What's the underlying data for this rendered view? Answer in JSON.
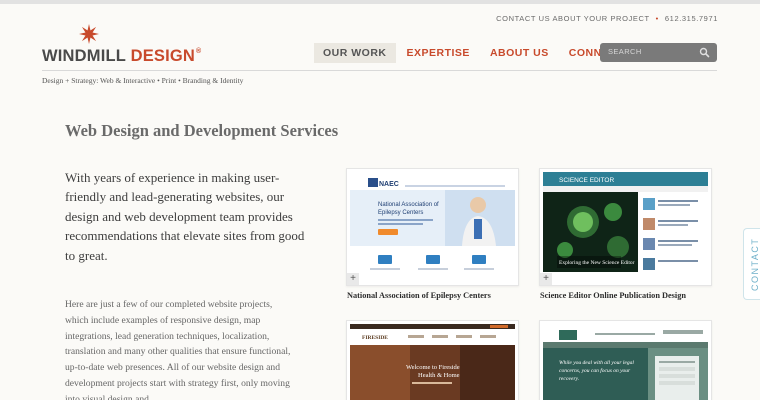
{
  "utility": {
    "contact_link": "CONTACT US ABOUT YOUR PROJECT",
    "separator": "•",
    "phone": "612.315.7971"
  },
  "logo": {
    "word1": "WINDMILL",
    "word2": "DESIGN",
    "mark": "®",
    "brand_color": "#c84a2c"
  },
  "nav": {
    "items": [
      {
        "label": "OUR WORK",
        "active": true
      },
      {
        "label": "EXPERTISE",
        "active": false
      },
      {
        "label": "ABOUT US",
        "active": false
      },
      {
        "label": "CONNECT",
        "active": false
      }
    ]
  },
  "search": {
    "placeholder": "SEARCH",
    "icon": "search-icon"
  },
  "tagline": "Design + Strategy: Web & Interactive • Print • Branding & Identity",
  "main": {
    "title": "Web Design and Development Services",
    "lead": "With years of experience in making user-friendly and lead-generating websites, our design and web development team provides recommendations that elevate sites from good to great.",
    "body": "Here are just a few of our completed website projects, which include examples of responsive design, map integrations, lead generation techniques, localization, translation and many other qualities that ensure functional, up-to-date web presences. All of our website design and development projects start with strategy first, only moving into visual design and"
  },
  "portfolio": [
    {
      "caption": "National Association of Epilepsy Centers",
      "expand": "+",
      "thumb_logo": "NAEC",
      "thumb_headline": "National Association of Epilepsy Centers",
      "thumb_button": "LEARN MORE"
    },
    {
      "caption": "Science Editor Online Publication Design",
      "expand": "+",
      "thumb_logo": "SCIENCE EDITOR",
      "thumb_headline": "Exploring the New Science Editor"
    },
    {
      "caption": "",
      "expand": "",
      "thumb_logo": "FIRESIDE",
      "thumb_headline": "Welcome to Fireside Health & Home"
    },
    {
      "caption": "",
      "expand": "",
      "thumb_headline": "While you deal with all your legal concerns, you can focus on your recovery."
    }
  ],
  "contact_tab": "CONTACT",
  "colors": {
    "accent": "#c84a2c",
    "nav_active_bg": "#ebe8e1",
    "search_bg": "#7a7a7a",
    "contact_tab_text": "#6fb0c9"
  }
}
